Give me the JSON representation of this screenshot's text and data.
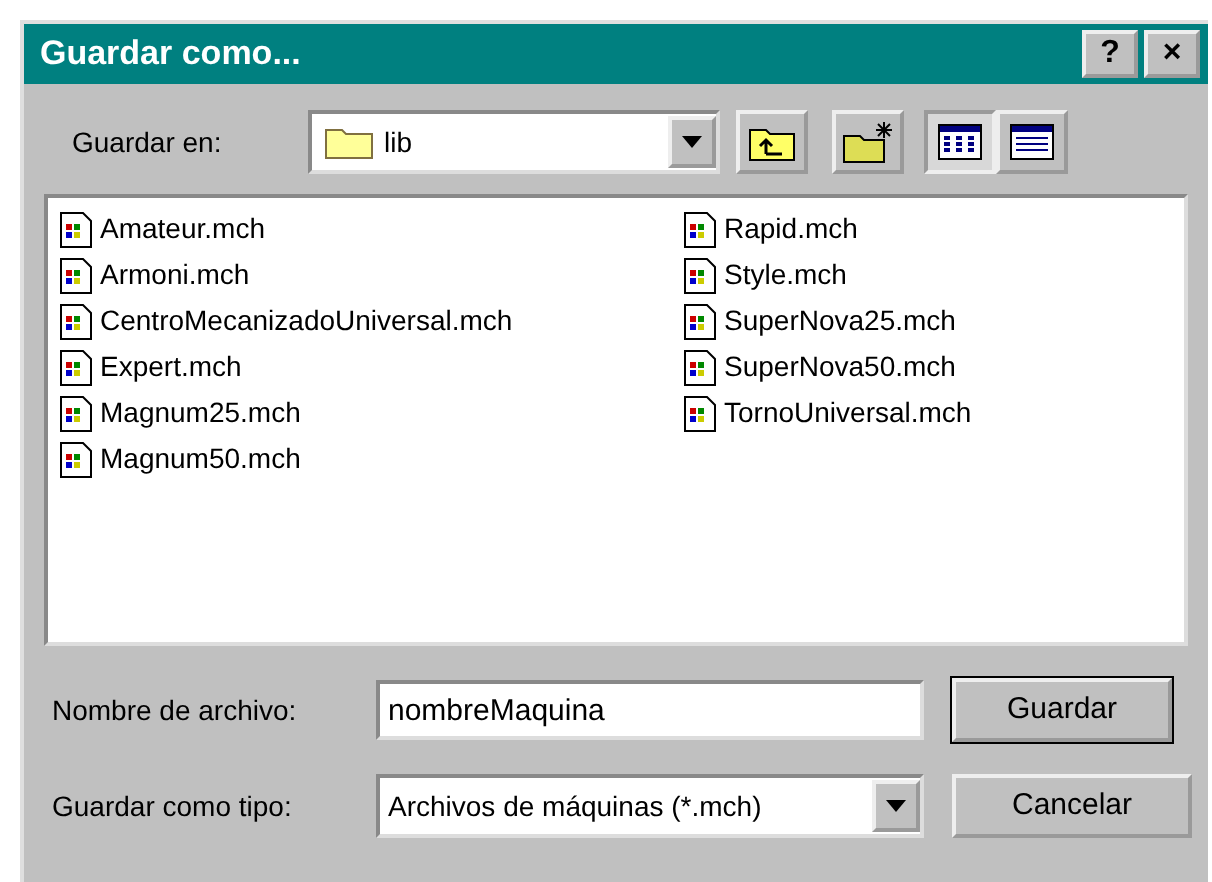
{
  "window": {
    "title": "Guardar como...",
    "title_buttons": [
      "?",
      "×"
    ]
  },
  "save_in": {
    "label": "Guardar en:",
    "value": "lib"
  },
  "files": [
    {
      "name": "Amateur.mch"
    },
    {
      "name": "Armoni.mch"
    },
    {
      "name": "CentroMecanizadoUniversal.mch"
    },
    {
      "name": "Expert.mch"
    },
    {
      "name": "Magnum25.mch"
    },
    {
      "name": "Magnum50.mch"
    },
    {
      "name": "Rapid.mch"
    },
    {
      "name": "Style.mch"
    },
    {
      "name": "SuperNova25.mch"
    },
    {
      "name": "SuperNova50.mch"
    },
    {
      "name": "TornoUniversal.mch"
    }
  ],
  "view_buttons": [
    {
      "kind": "list",
      "selected": true
    },
    {
      "kind": "details",
      "selected": false
    }
  ],
  "file_name": {
    "label": "Nombre de archivo:",
    "value": "nombreMaquina"
  },
  "file_type": {
    "label": "Guardar como tipo:",
    "value": "Archivos de máquinas (*.mch)"
  },
  "buttons": [
    "Guardar",
    "Cancelar"
  ]
}
